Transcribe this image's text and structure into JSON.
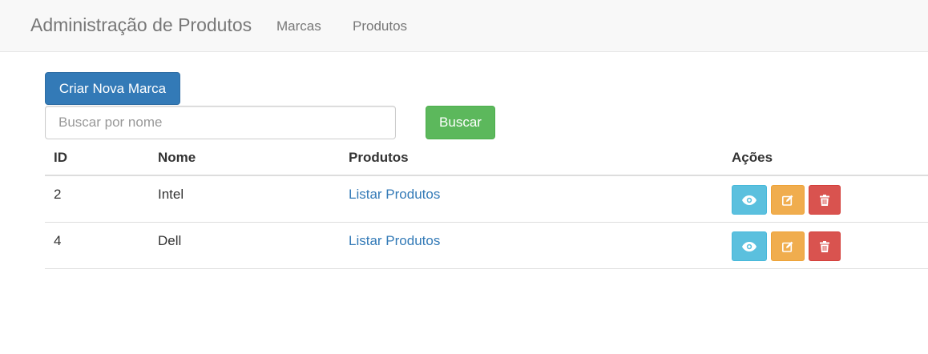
{
  "navbar": {
    "brand": "Administração de Produtos",
    "links": [
      "Marcas",
      "Produtos"
    ]
  },
  "actions": {
    "create_label": "Criar Nova Marca",
    "search_placeholder": "Buscar por nome",
    "search_value": "",
    "search_button_label": "Buscar"
  },
  "table": {
    "headers": [
      "ID",
      "Nome",
      "Produtos",
      "Ações"
    ],
    "rows": [
      {
        "id": "2",
        "nome": "Intel",
        "produtos_link": "Listar Produtos"
      },
      {
        "id": "4",
        "nome": "Dell",
        "produtos_link": "Listar Produtos"
      }
    ],
    "row_action_icons": [
      "eye-icon",
      "edit-icon",
      "trash-icon"
    ]
  },
  "colors": {
    "primary": "#337ab7",
    "success": "#5cb85c",
    "info": "#5bc0de",
    "warning": "#f0ad4e",
    "danger": "#d9534f"
  }
}
